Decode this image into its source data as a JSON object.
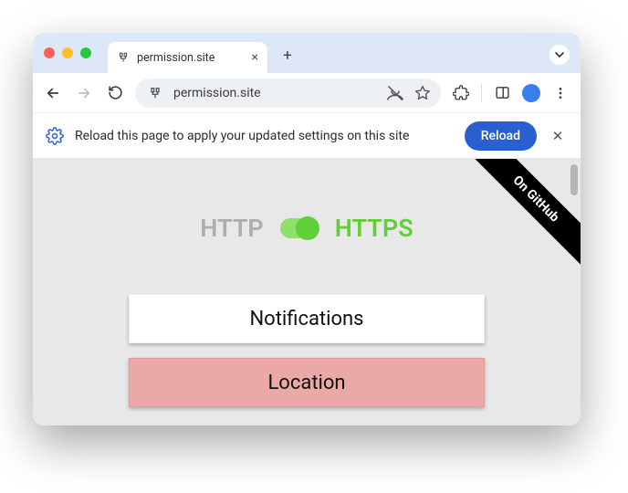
{
  "tab": {
    "title": "permission.site"
  },
  "omnibox": {
    "url": "permission.site"
  },
  "infobar": {
    "message": "Reload this page to apply your updated settings on this site",
    "reload_label": "Reload"
  },
  "content": {
    "ribbon": "On GitHub",
    "protocol": {
      "http": "HTTP",
      "https": "HTTPS"
    },
    "buttons": {
      "notifications": "Notifications",
      "location": "Location"
    }
  }
}
